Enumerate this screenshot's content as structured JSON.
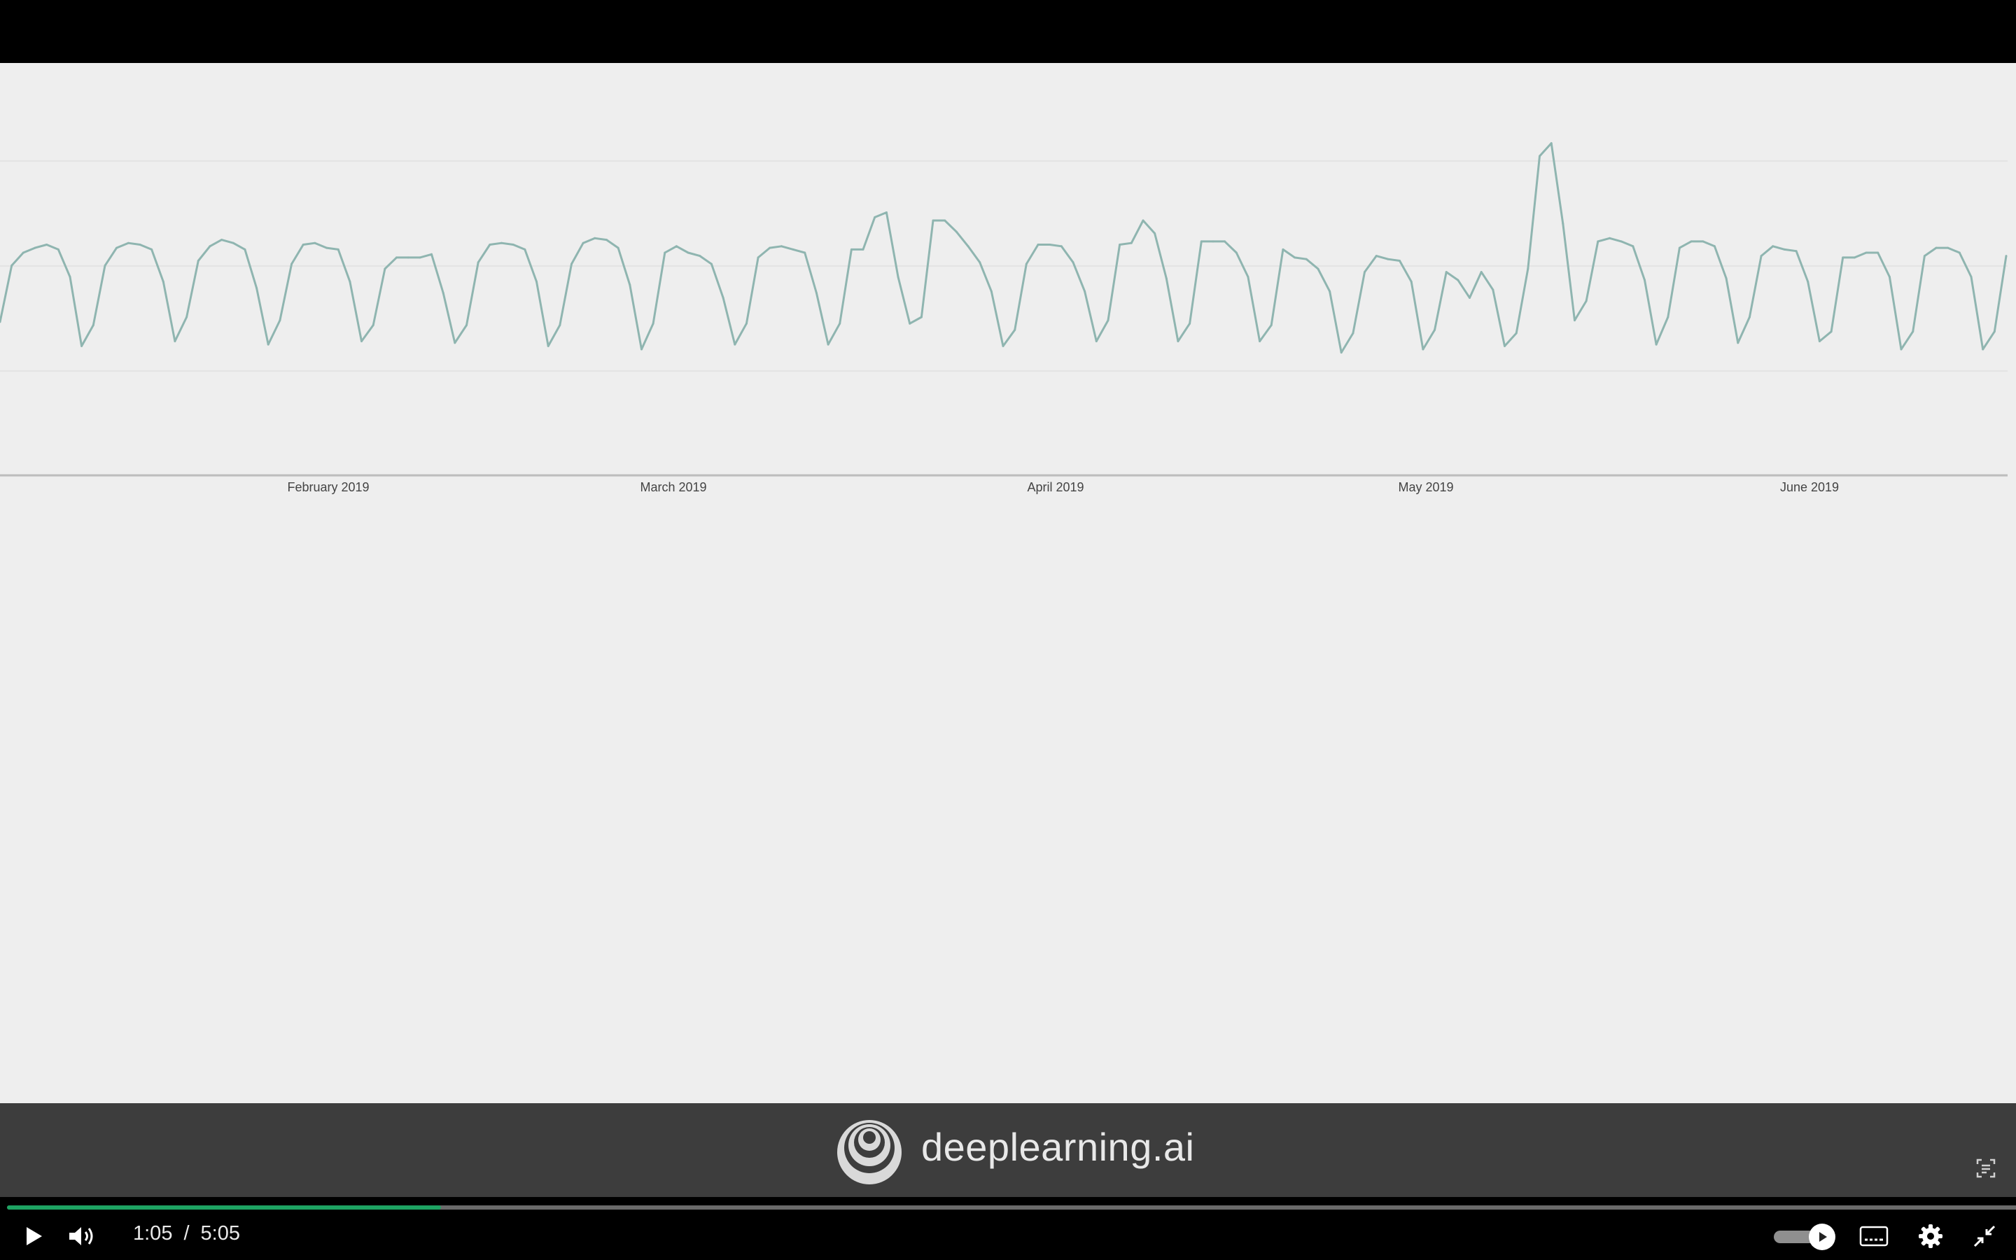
{
  "brand": {
    "name": "deeplearning.ai"
  },
  "player": {
    "current_time": "1:05",
    "separator": "/",
    "duration": "5:05",
    "progress_fraction": 0.2131,
    "accent_color": "#1ea362"
  },
  "icons": {
    "play": "play-icon",
    "volume": "volume-icon",
    "autoplay": "autoplay-toggle",
    "captions": "captions-icon",
    "settings": "gear-icon",
    "exit_fullscreen": "exit-fullscreen-icon",
    "transcript": "transcript-icon"
  },
  "chart_data": {
    "type": "line",
    "x_ticks": [
      "February 2019",
      "March 2019",
      "April 2019",
      "May 2019",
      "June 2019"
    ],
    "title": "",
    "xlabel": "",
    "ylabel": "",
    "grid": true,
    "line_color": "#8fb5b0",
    "series": [
      {
        "values": [
          0.27,
          0.62,
          0.7,
          0.73,
          0.75,
          0.72,
          0.55,
          0.12,
          0.25,
          0.62,
          0.73,
          0.76,
          0.75,
          0.72,
          0.52,
          0.15,
          0.3,
          0.65,
          0.74,
          0.78,
          0.76,
          0.72,
          0.48,
          0.13,
          0.28,
          0.63,
          0.75,
          0.76,
          0.73,
          0.72,
          0.52,
          0.15,
          0.25,
          0.6,
          0.67,
          0.67,
          0.67,
          0.69,
          0.45,
          0.14,
          0.25,
          0.64,
          0.75,
          0.76,
          0.75,
          0.72,
          0.52,
          0.12,
          0.25,
          0.63,
          0.76,
          0.79,
          0.78,
          0.73,
          0.5,
          0.1,
          0.26,
          0.7,
          0.74,
          0.7,
          0.68,
          0.63,
          0.42,
          0.13,
          0.26,
          0.67,
          0.73,
          0.74,
          0.72,
          0.7,
          0.45,
          0.13,
          0.26,
          0.72,
          0.72,
          0.92,
          0.95,
          0.55,
          0.26,
          0.3,
          0.9,
          0.9,
          0.83,
          0.74,
          0.64,
          0.46,
          0.12,
          0.22,
          0.63,
          0.75,
          0.75,
          0.74,
          0.64,
          0.46,
          0.15,
          0.28,
          0.75,
          0.76,
          0.9,
          0.82,
          0.54,
          0.15,
          0.26,
          0.77,
          0.77,
          0.77,
          0.7,
          0.55,
          0.15,
          0.25,
          0.72,
          0.67,
          0.66,
          0.6,
          0.46,
          0.08,
          0.2,
          0.58,
          0.68,
          0.66,
          0.65,
          0.52,
          0.1,
          0.22,
          0.58,
          0.53,
          0.42,
          0.58,
          0.47,
          0.12,
          0.2,
          0.6,
          1.3,
          1.38,
          0.88,
          0.28,
          0.4,
          0.77,
          0.79,
          0.77,
          0.74,
          0.53,
          0.13,
          0.3,
          0.73,
          0.77,
          0.77,
          0.74,
          0.54,
          0.14,
          0.3,
          0.68,
          0.74,
          0.72,
          0.71,
          0.52,
          0.15,
          0.21,
          0.67,
          0.67,
          0.7,
          0.7,
          0.55,
          0.1,
          0.21,
          0.68,
          0.73,
          0.73,
          0.7,
          0.55,
          0.1,
          0.21,
          0.68
        ]
      }
    ]
  }
}
